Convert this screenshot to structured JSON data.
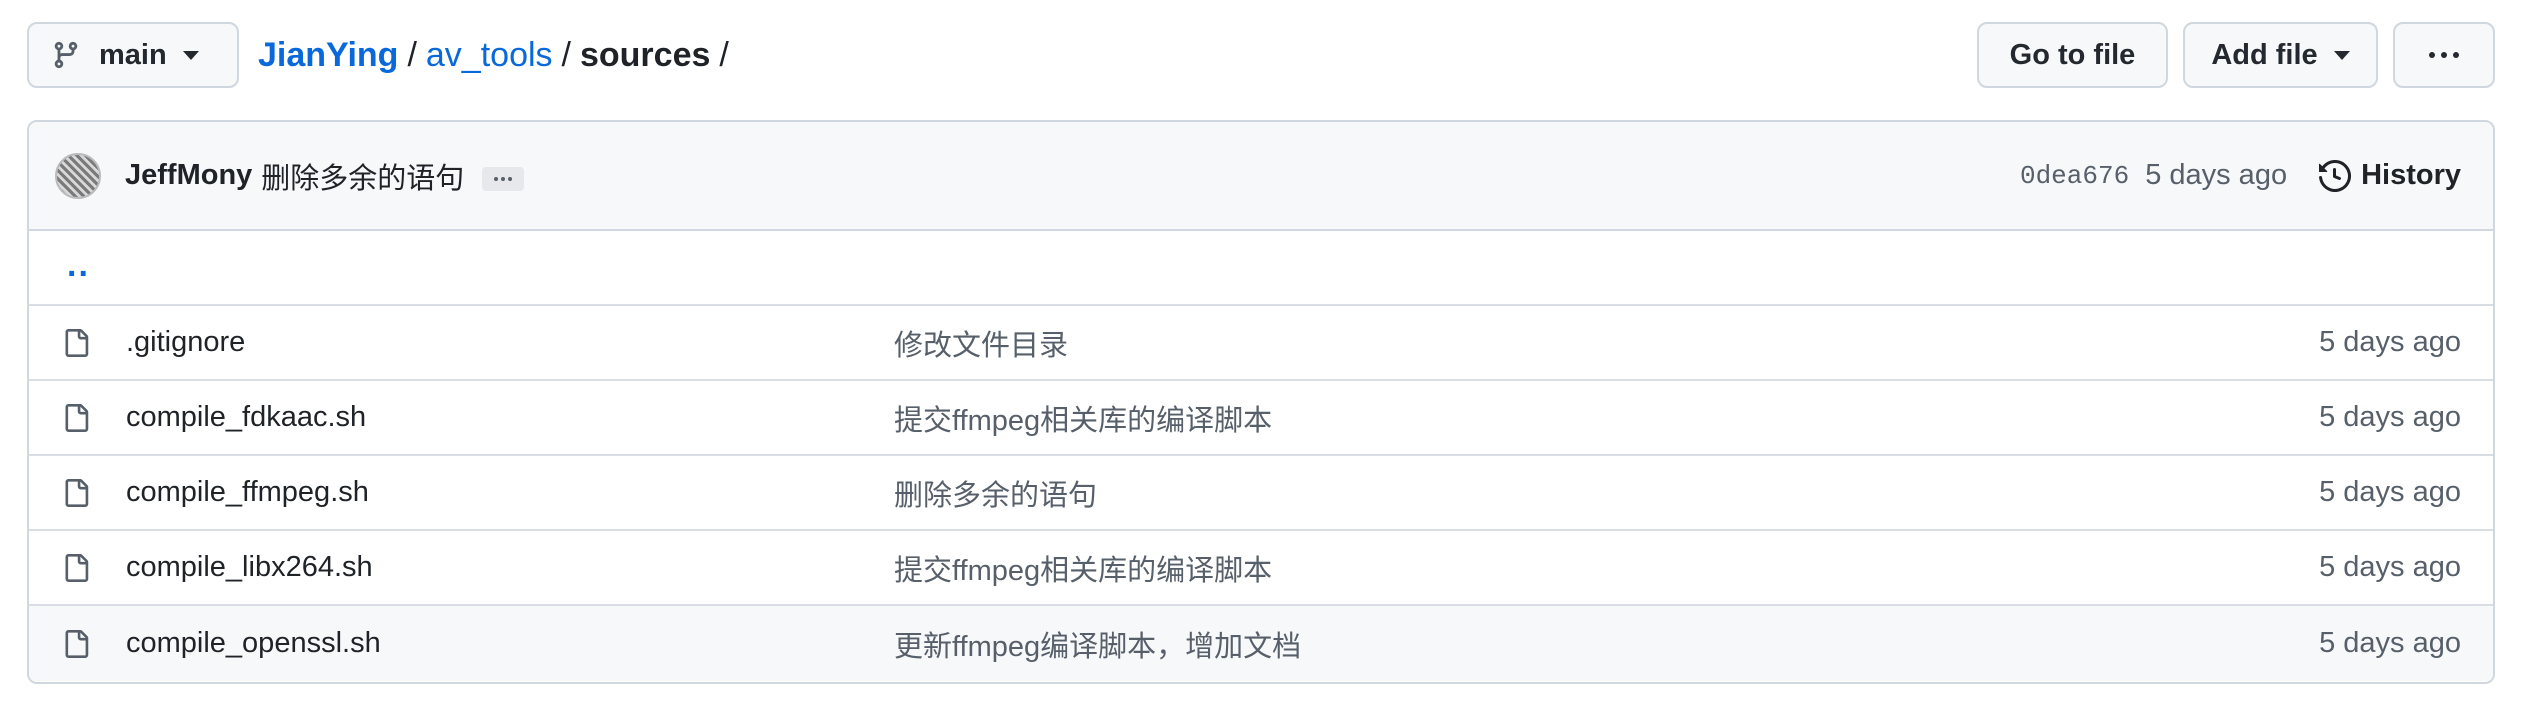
{
  "toolbar": {
    "branch_label": "main",
    "goto_file_label": "Go to file",
    "add_file_label": "Add file"
  },
  "breadcrumb": {
    "owner": "JianYing",
    "repo": "av_tools",
    "current": "sources",
    "separator": "/"
  },
  "commit": {
    "author": "JeffMony",
    "message": "删除多余的语句",
    "sha": "0dea676",
    "time": "5 days ago",
    "history_label": "History"
  },
  "parent_dir": "..",
  "files": [
    {
      "name": ".gitignore",
      "message": "修改文件目录",
      "time": "5 days ago"
    },
    {
      "name": "compile_fdkaac.sh",
      "message": "提交ffmpeg相关库的编译脚本",
      "time": "5 days ago"
    },
    {
      "name": "compile_ffmpeg.sh",
      "message": "删除多余的语句",
      "time": "5 days ago"
    },
    {
      "name": "compile_libx264.sh",
      "message": "提交ffmpeg相关库的编译脚本",
      "time": "5 days ago"
    },
    {
      "name": "compile_openssl.sh",
      "message": "更新ffmpeg编译脚本，增加文档",
      "time": "5 days ago"
    }
  ],
  "colors": {
    "link": "#0969da",
    "muted": "#57606a",
    "border": "#d0d7de",
    "header_bg": "#f6f8fa"
  }
}
